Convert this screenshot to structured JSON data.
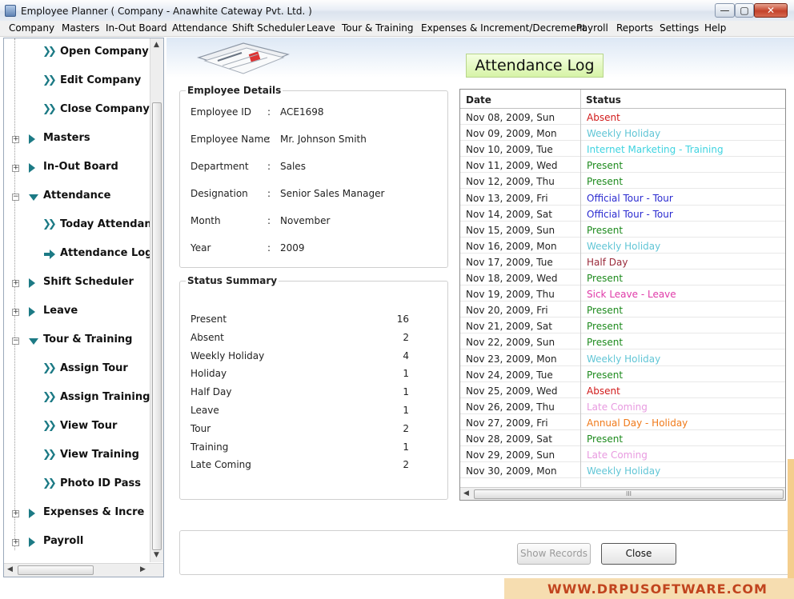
{
  "window": {
    "title": "Employee Planner ( Company - Anawhite Cateway Pvt. Ltd. )",
    "min_glyph": "—",
    "max_glyph": "▢",
    "close_glyph": "✕"
  },
  "menu": [
    "Company",
    "Masters",
    "In-Out Board",
    "Attendance",
    "Shift Scheduler",
    "Leave",
    "Tour & Training",
    "Expenses & Increment/Decrement",
    "Payroll",
    "Reports",
    "Settings",
    "Help"
  ],
  "tree": {
    "open_company": "Open Company",
    "edit_company": "Edit Company",
    "close_company": "Close Company",
    "masters": "Masters",
    "in_out_board": "In-Out Board",
    "attendance": "Attendance",
    "today_attendance": "Today Attendan",
    "attendance_log": "Attendance Log",
    "shift_scheduler": "Shift Scheduler",
    "leave": "Leave",
    "tour_training": "Tour & Training",
    "assign_tour": "Assign Tour",
    "assign_training": "Assign Training",
    "view_tour": "View Tour",
    "view_training": "View Training",
    "photo_id_pass": "Photo ID Pass",
    "expenses": "Expenses & Incre",
    "payroll": "Payroll",
    "plus_glyph": "+",
    "minus_glyph": "−",
    "arrow_glyph": "❯❯"
  },
  "page_title": "Attendance Log",
  "employee_details": {
    "title": "Employee Details",
    "colon": ":",
    "id_label": "Employee ID",
    "id_value": "ACE1698",
    "name_label": "Employee Name",
    "name_value": "Mr. Johnson Smith",
    "dept_label": "Department",
    "dept_value": "Sales",
    "desig_label": "Designation",
    "desig_value": "Senior Sales Manager",
    "month_label": "Month",
    "month_value": "November",
    "year_label": "Year",
    "year_value": "2009"
  },
  "status_summary": {
    "title": "Status Summary",
    "rows": [
      {
        "label": "Present",
        "count": "16"
      },
      {
        "label": "Absent",
        "count": "2"
      },
      {
        "label": "Weekly Holiday",
        "count": "4"
      },
      {
        "label": "Holiday",
        "count": "1"
      },
      {
        "label": "Half Day",
        "count": "1"
      },
      {
        "label": "Leave",
        "count": "1"
      },
      {
        "label": "Tour",
        "count": "2"
      },
      {
        "label": "Training",
        "count": "1"
      },
      {
        "label": "Late Coming",
        "count": "2"
      }
    ]
  },
  "log": {
    "col_date": "Date",
    "col_status": "Status",
    "scroll_grip": "III",
    "rows": [
      {
        "date": "Nov 08, 2009,  Sun",
        "status": "Absent",
        "color": "#d11a1a"
      },
      {
        "date": "Nov 09, 2009,  Mon",
        "status": "Weekly Holiday",
        "color": "#62c6d6"
      },
      {
        "date": "Nov 10, 2009,  Tue",
        "status": "Internet Marketing - Training",
        "color": "#3fd3e0"
      },
      {
        "date": "Nov 11, 2009,  Wed",
        "status": "Present",
        "color": "#1d8a1d"
      },
      {
        "date": "Nov 12, 2009,  Thu",
        "status": "Present",
        "color": "#1d8a1d"
      },
      {
        "date": "Nov 13, 2009,  Fri",
        "status": "Official Tour - Tour",
        "color": "#2a2ad0"
      },
      {
        "date": "Nov 14, 2009,  Sat",
        "status": "Official Tour - Tour",
        "color": "#2a2ad0"
      },
      {
        "date": "Nov 15, 2009,  Sun",
        "status": "Present",
        "color": "#1d8a1d"
      },
      {
        "date": "Nov 16, 2009,  Mon",
        "status": "Weekly Holiday",
        "color": "#62c6d6"
      },
      {
        "date": "Nov 17, 2009,  Tue",
        "status": "Half Day",
        "color": "#9a2a3a"
      },
      {
        "date": "Nov 18, 2009,  Wed",
        "status": "Present",
        "color": "#1d8a1d"
      },
      {
        "date": "Nov 19, 2009,  Thu",
        "status": "Sick Leave - Leave",
        "color": "#e03aa8"
      },
      {
        "date": "Nov 20, 2009,  Fri",
        "status": "Present",
        "color": "#1d8a1d"
      },
      {
        "date": "Nov 21, 2009,  Sat",
        "status": "Present",
        "color": "#1d8a1d"
      },
      {
        "date": "Nov 22, 2009,  Sun",
        "status": "Present",
        "color": "#1d8a1d"
      },
      {
        "date": "Nov 23, 2009,  Mon",
        "status": "Weekly Holiday",
        "color": "#62c6d6"
      },
      {
        "date": "Nov 24, 2009,  Tue",
        "status": "Present",
        "color": "#1d8a1d"
      },
      {
        "date": "Nov 25, 2009,  Wed",
        "status": "Absent",
        "color": "#d11a1a"
      },
      {
        "date": "Nov 26, 2009,  Thu",
        "status": "Late Coming",
        "color": "#e89ae0"
      },
      {
        "date": "Nov 27, 2009,  Fri",
        "status": "Annual Day - Holiday",
        "color": "#f07a1a"
      },
      {
        "date": "Nov 28, 2009,  Sat",
        "status": "Present",
        "color": "#1d8a1d"
      },
      {
        "date": "Nov 29, 2009,  Sun",
        "status": "Late Coming",
        "color": "#e89ae0"
      },
      {
        "date": "Nov 30, 2009,  Mon",
        "status": "Weekly Holiday",
        "color": "#62c6d6"
      }
    ]
  },
  "buttons": {
    "show_records": "Show Records",
    "close": "Close"
  },
  "watermark": "WWW.DRPUSOFTWARE.COM"
}
